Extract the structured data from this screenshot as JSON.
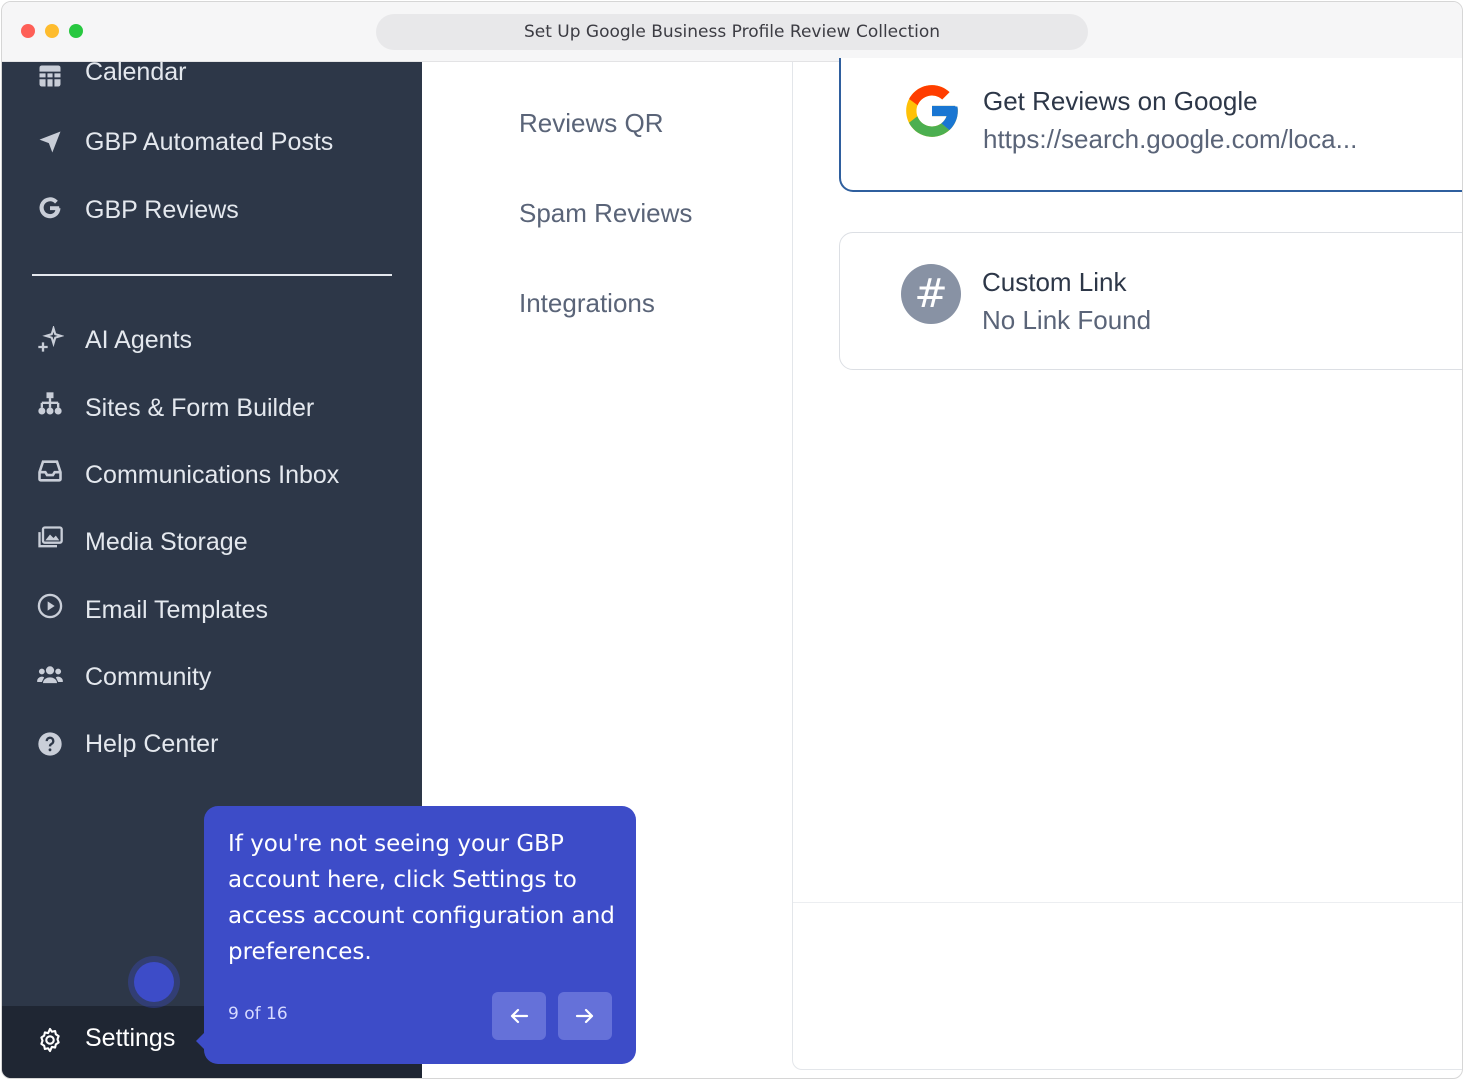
{
  "browser": {
    "title": "Set Up Google Business Profile Review Collection"
  },
  "sidebar": {
    "items": [
      {
        "label": "Calendar",
        "icon": "calendar-icon"
      },
      {
        "label": "GBP Automated Posts",
        "icon": "send-arrow-icon"
      },
      {
        "label": "GBP Reviews",
        "icon": "google-g-icon"
      },
      {
        "label": "AI Agents",
        "icon": "sparkles-icon"
      },
      {
        "label": "Sites & Form Builder",
        "icon": "sitemap-icon"
      },
      {
        "label": "Communications Inbox",
        "icon": "inbox-icon"
      },
      {
        "label": "Media Storage",
        "icon": "images-icon"
      },
      {
        "label": "Email Templates",
        "icon": "play-circle-icon"
      },
      {
        "label": "Community",
        "icon": "users-icon"
      },
      {
        "label": "Help Center",
        "icon": "question-circle-icon"
      }
    ],
    "settings_label": "Settings"
  },
  "subnav": {
    "items": [
      "Reviews QR",
      "Spam Reviews",
      "Integrations"
    ]
  },
  "cards": {
    "google": {
      "title": "Get Reviews on Google",
      "subtitle": "https://search.google.com/loca..."
    },
    "custom": {
      "title": "Custom Link",
      "subtitle": "No Link Found",
      "icon_symbol": "#"
    }
  },
  "tooltip": {
    "text": "If you're not seeing your GBP account here, click Settings to access account configuration and preferences.",
    "step": "9 of 16"
  },
  "colors": {
    "sidebar_bg": "#2d3748",
    "tooltip_bg": "#3d4cc8",
    "google_card_border": "#2f5f9e"
  }
}
